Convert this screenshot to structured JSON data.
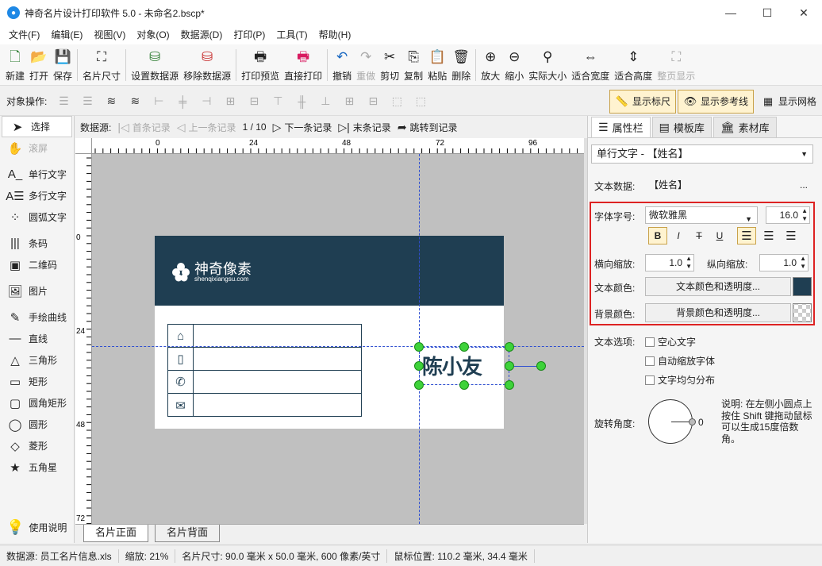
{
  "window": {
    "title": "神奇名片设计打印软件 5.0 - 未命名2.bscp*",
    "minimize": "—",
    "maximize": "☐",
    "close": "✕"
  },
  "menu": [
    "文件(F)",
    "编辑(E)",
    "视图(V)",
    "对象(O)",
    "数据源(D)",
    "打印(P)",
    "工具(T)",
    "帮助(H)"
  ],
  "toolbar": [
    {
      "label": "新建",
      "icon": "new-file-icon"
    },
    {
      "label": "打开",
      "icon": "open-icon"
    },
    {
      "label": "保存",
      "icon": "save-icon"
    },
    {
      "label": "名片尺寸",
      "icon": "card-size-icon"
    },
    {
      "label": "设置数据源",
      "icon": "database-add-icon"
    },
    {
      "label": "移除数据源",
      "icon": "database-remove-icon"
    },
    {
      "label": "打印预览",
      "icon": "print-preview-icon"
    },
    {
      "label": "直接打印",
      "icon": "print-icon"
    },
    {
      "label": "撤销",
      "icon": "undo-icon"
    },
    {
      "label": "重做",
      "icon": "redo-icon"
    },
    {
      "label": "剪切",
      "icon": "cut-icon"
    },
    {
      "label": "复制",
      "icon": "copy-icon"
    },
    {
      "label": "粘贴",
      "icon": "paste-icon"
    },
    {
      "label": "删除",
      "icon": "delete-icon"
    },
    {
      "label": "放大",
      "icon": "zoom-in-icon"
    },
    {
      "label": "缩小",
      "icon": "zoom-out-icon"
    },
    {
      "label": "实际大小",
      "icon": "actual-size-icon"
    },
    {
      "label": "适合宽度",
      "icon": "fit-width-icon"
    },
    {
      "label": "适合高度",
      "icon": "fit-height-icon"
    },
    {
      "label": "整页显示",
      "icon": "full-page-icon"
    }
  ],
  "objbar": {
    "label": "对象操作:",
    "show_ruler": "显示标尺",
    "show_guides": "显示参考线",
    "show_grid": "显示网格"
  },
  "tools": [
    "选择",
    "滚屏",
    "单行文字",
    "多行文字",
    "圆弧文字",
    "条码",
    "二维码",
    "图片",
    "手绘曲线",
    "直线",
    "三角形",
    "矩形",
    "圆角矩形",
    "圆形",
    "菱形",
    "五角星"
  ],
  "help_label": "使用说明",
  "nav": {
    "label": "数据源:",
    "first": "首条记录",
    "prev": "上一条记录",
    "page": "1 / 10",
    "next": "下一条记录",
    "last": "末条记录",
    "goto": "跳转到记录"
  },
  "ruler": {
    "top": [
      "0",
      "24",
      "48",
      "72",
      "96"
    ],
    "left": [
      "0",
      "24",
      "48",
      "72"
    ]
  },
  "card": {
    "logo_text": "神奇像素",
    "logo_sub": "shenqixiangsu.com",
    "name": "陈小友"
  },
  "page_tabs": [
    "名片正面",
    "名片背面"
  ],
  "right_panel": {
    "tabs": [
      "属性栏",
      "模板库",
      "素材库"
    ],
    "object_select": "单行文字 - 【姓名】",
    "text_data_label": "文本数据:",
    "text_data_value": "【姓名】",
    "text_data_more": "...",
    "font_label": "字体字号:",
    "font_name": "微软雅黑",
    "font_size": "16.0",
    "h_scale_label": "横向缩放:",
    "h_scale": "1.0",
    "v_scale_label": "纵向缩放:",
    "v_scale": "1.0",
    "text_color_label": "文本颜色:",
    "text_color_btn": "文本颜色和透明度...",
    "bg_color_label": "背景颜色:",
    "bg_color_btn": "背景颜色和透明度...",
    "text_options_label": "文本选项:",
    "opt_hollow": "空心文字",
    "opt_autoscale": "自动缩放字体",
    "opt_distribute": "文字均匀分布",
    "rotation_label": "旋转角度:",
    "rotation_value": "0",
    "rotation_note": "说明: 在左侧小圆点上按住 Shift 键拖动鼠标可以生成15度倍数角。"
  },
  "status": {
    "datasource": "数据源: 员工名片信息.xls",
    "zoom": "缩放: 21%",
    "card_size": "名片尺寸: 90.0 毫米 x 50.0 毫米, 600 像素/英寸",
    "mouse_pos": "鼠标位置: 110.2 毫米, 34.4 毫米"
  },
  "colors": {
    "card_header": "#1f3e52",
    "text_color": "#1f3e52",
    "handle": "#3ed23a",
    "guide": "#3050d0",
    "highlight": "#d22222"
  }
}
